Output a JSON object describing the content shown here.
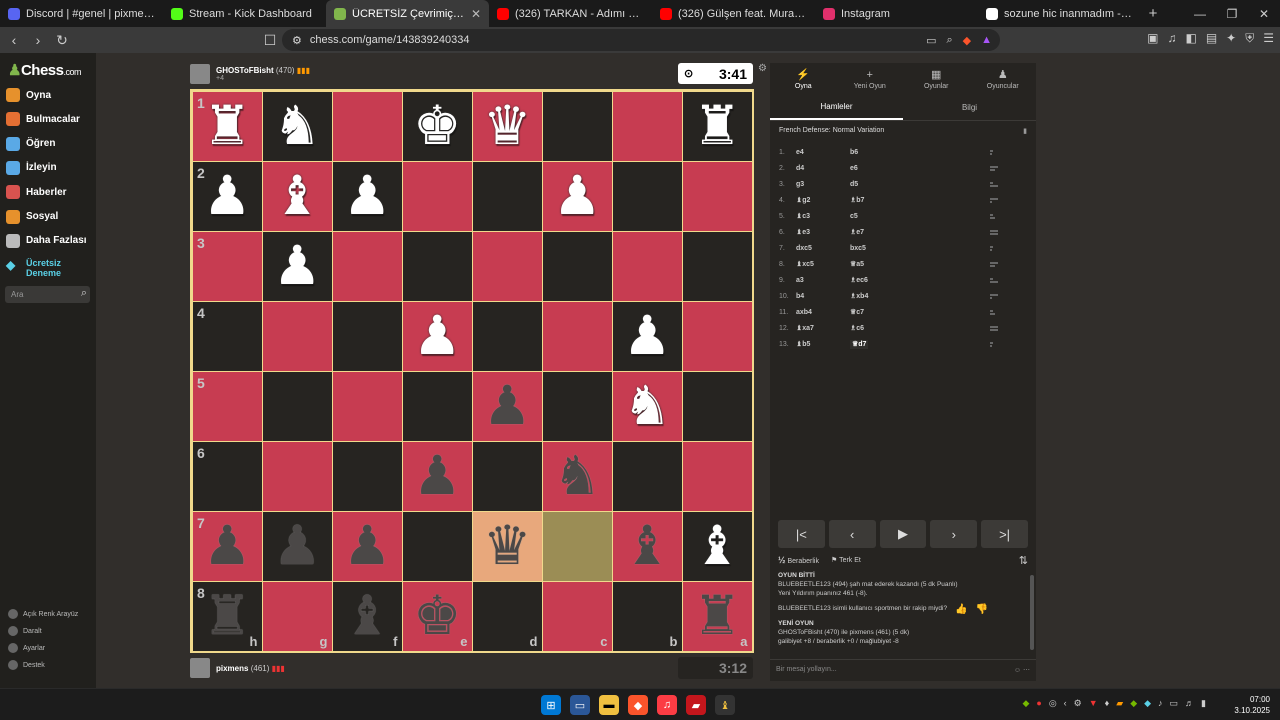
{
  "browser": {
    "tabs": [
      {
        "title": "Discord | #genel | pixmens",
        "color": "#5865f2",
        "active": false
      },
      {
        "title": "Stream - Kick Dashboard",
        "color": "#53fc18",
        "active": false
      },
      {
        "title": "ÜCRETSİZ Çevrimiçi Satranç Oyn",
        "color": "#81b64c",
        "active": true
      },
      {
        "title": "(326) TARKAN - Adımı Kalbine Ya",
        "color": "#ff0000",
        "active": false
      },
      {
        "title": "(326) Gülşen feat. Murat Boz - İltima",
        "color": "#ff0000",
        "active": false
      },
      {
        "title": "Instagram",
        "color": "#e1306c",
        "active": false
      },
      {
        "title": "sozune hic inanmadım - Google'da A",
        "color": "#ffffff",
        "active": false
      }
    ],
    "new_tab": "+",
    "url": "chess.com/game/143839240334"
  },
  "sidebar": {
    "logo_main": "Chess",
    "logo_suffix": ".com",
    "items": [
      {
        "label": "Oyna",
        "color": "#e6912c"
      },
      {
        "label": "Bulmacalar",
        "color": "#e46f33"
      },
      {
        "label": "Öğren",
        "color": "#5aa9e6"
      },
      {
        "label": "İzleyin",
        "color": "#5aa9e6"
      },
      {
        "label": "Haberler",
        "color": "#d9534f"
      },
      {
        "label": "Sosyal",
        "color": "#e6912c"
      },
      {
        "label": "Daha Fazlası",
        "color": "#bbbbbb"
      }
    ],
    "trial": "Ücretsiz Deneme",
    "search_placeholder": "Ara",
    "bottom": [
      "Açık Renk Arayüz",
      "Daralt",
      "Ayarlar",
      "Destek"
    ]
  },
  "top_player": {
    "name": "GHOSToFBisht",
    "rating": "(470)",
    "sub": "+4",
    "clock": "3:41"
  },
  "bottom_player": {
    "name": "pixmens",
    "rating": "(461)",
    "clock": "3:12"
  },
  "board": {
    "ranks": [
      "1",
      "2",
      "3",
      "4",
      "5",
      "6",
      "7",
      "8"
    ],
    "files": [
      "h",
      "g",
      "f",
      "e",
      "d",
      "c",
      "b",
      "a"
    ],
    "rows": [
      [
        "wR",
        "wN",
        "",
        "wK",
        "wQ",
        "",
        "",
        "wR"
      ],
      [
        "wP",
        "wB",
        "wP",
        "",
        "",
        "wP",
        "",
        ""
      ],
      [
        "",
        "wP",
        "",
        "",
        "",
        "",
        "",
        ""
      ],
      [
        "",
        "",
        "",
        "wP",
        "",
        "",
        "wP",
        ""
      ],
      [
        "",
        "",
        "",
        "",
        "bP",
        "",
        "wN",
        ""
      ],
      [
        "",
        "",
        "",
        "bP",
        "",
        "bN",
        "",
        ""
      ],
      [
        "bP",
        "bP",
        "bP",
        "",
        "bQ",
        "",
        "bB",
        "wB"
      ],
      [
        "bR",
        "",
        "bB",
        "bK",
        "",
        "",
        "",
        "bR"
      ]
    ]
  },
  "panel": {
    "tabs": [
      {
        "label": "Oyna",
        "icon": "⚡"
      },
      {
        "label": "Yeni Oyun",
        "icon": "+"
      },
      {
        "label": "Oyunlar",
        "icon": "▦"
      },
      {
        "label": "Oyuncular",
        "icon": "♟"
      }
    ],
    "subtabs": [
      "Hamleler",
      "Bilgi"
    ],
    "opening": "French Defense: Normal Variation",
    "moves": [
      {
        "n": "1.",
        "w": "e4",
        "b": "b6"
      },
      {
        "n": "2.",
        "w": "d4",
        "b": "e6"
      },
      {
        "n": "3.",
        "w": "g3",
        "b": "d5"
      },
      {
        "n": "4.",
        "w": "♝g2",
        "b": "♗b7"
      },
      {
        "n": "5.",
        "w": "♝c3",
        "b": "c5"
      },
      {
        "n": "6.",
        "w": "♝e3",
        "b": "♗e7"
      },
      {
        "n": "7.",
        "w": "dxc5",
        "b": "bxc5"
      },
      {
        "n": "8.",
        "w": "♝xc5",
        "b": "♕a5"
      },
      {
        "n": "9.",
        "w": "a3",
        "b": "♗ec6"
      },
      {
        "n": "10.",
        "w": "b4",
        "b": "♗xb4"
      },
      {
        "n": "11.",
        "w": "axb4",
        "b": "♕c7"
      },
      {
        "n": "12.",
        "w": "♝xa7",
        "b": "♗c6"
      },
      {
        "n": "13.",
        "w": "♝b5",
        "b": "♕d7"
      }
    ],
    "actions": {
      "draw": "Beraberlik",
      "resign": "Terk Et"
    },
    "chat": [
      {
        "bold": "OYUN BİTTİ",
        "lines": [
          "BLUEBEETLE123 (494) şah mat ederek kazandı (5 dk Puanlı)",
          "Yeni Yıldırım puanınız 461 (-8)."
        ]
      },
      {
        "bold": "",
        "lines": [
          "BLUEBEETLE123 isimli kullanıcı sportmen bir rakip miydi?"
        ]
      },
      {
        "bold": "YENİ OYUN",
        "lines": [
          "GHOSToFBisht (470) ile pixmens (461) (5 dk)",
          "galibiyet +8 / beraberlik +0 / mağlubiyet -8"
        ]
      }
    ],
    "message_placeholder": "Bir mesaj yollayın..."
  },
  "taskbar": {
    "time": "07:00",
    "date": "3.10.2025"
  }
}
